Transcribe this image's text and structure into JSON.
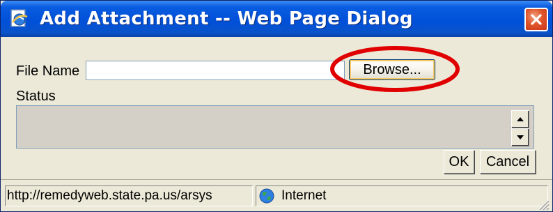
{
  "window": {
    "title": "Add Attachment -- Web Page Dialog",
    "accent_color": "#0a5ce0",
    "close_button_color": "#e0562a",
    "icons": {
      "app": "ie-page-icon",
      "close": "close-icon"
    }
  },
  "form": {
    "file_name_label": "File Name",
    "file_name_value": "",
    "browse_label": "Browse...",
    "status_label": "Status",
    "status_value": "",
    "highlight_color": "#e00000"
  },
  "buttons": {
    "ok_label": "OK",
    "cancel_label": "Cancel"
  },
  "statusbar": {
    "url": "http://remedyweb.state.pa.us/arsys",
    "zone": "Internet",
    "zone_icon": "globe-icon"
  }
}
